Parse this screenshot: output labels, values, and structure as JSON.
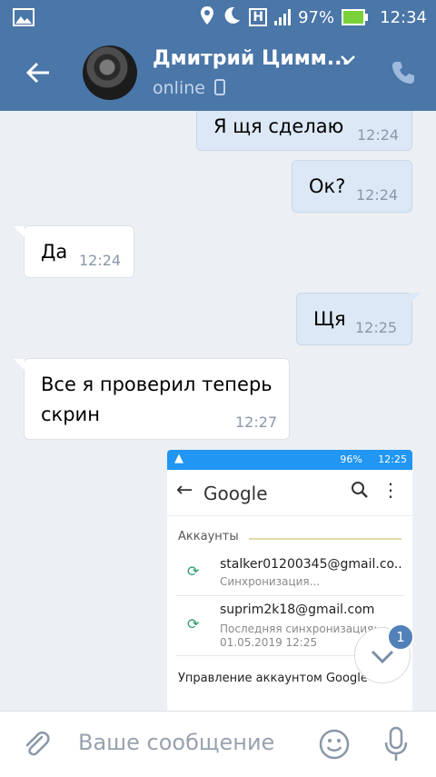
{
  "status_bar": {
    "battery_percent": "97%",
    "time": "12:34",
    "network_label": "H"
  },
  "header": {
    "contact_name": "Дмитрий Цимм...",
    "status": "online"
  },
  "messages": [
    {
      "direction": "out",
      "text": "Я щя сделаю",
      "time": "12:24"
    },
    {
      "direction": "out",
      "text": "Ок?",
      "time": "12:24"
    },
    {
      "direction": "in",
      "text": "Да",
      "time": "12:24"
    },
    {
      "direction": "out",
      "text": "Щя",
      "time": "12:25"
    },
    {
      "direction": "in",
      "text_line1": "Все я проверил теперь",
      "text_line2": "скрин",
      "time": "12:27"
    }
  ],
  "screenshot": {
    "status_battery": "96%",
    "status_time": "12:25",
    "title": "Google",
    "section": "Аккаунты",
    "accounts": [
      {
        "email": "stalker01200345@gmail.co..",
        "sub1": "Синхронизация...",
        "sub2": ""
      },
      {
        "email": "suprim2k18@gmail.com",
        "sub1": "Последняя синхронизация:",
        "sub2": "01.05.2019 12:25"
      }
    ],
    "manage": "Управление аккаунтом Google"
  },
  "scroll_badge": "1",
  "composer": {
    "placeholder": "Ваше сообщение"
  },
  "colors": {
    "accent": "#4a76a8",
    "out_bubble": "#dce8f6",
    "in_bubble": "#ffffff",
    "chat_bg": "#eceff3"
  },
  "icons": [
    "image-icon",
    "location-icon",
    "moon-icon",
    "signal-icon",
    "battery-icon",
    "back-arrow-icon",
    "chevron-down-icon",
    "phone-icon",
    "device-icon",
    "attach-icon",
    "emoji-icon",
    "mic-icon"
  ]
}
